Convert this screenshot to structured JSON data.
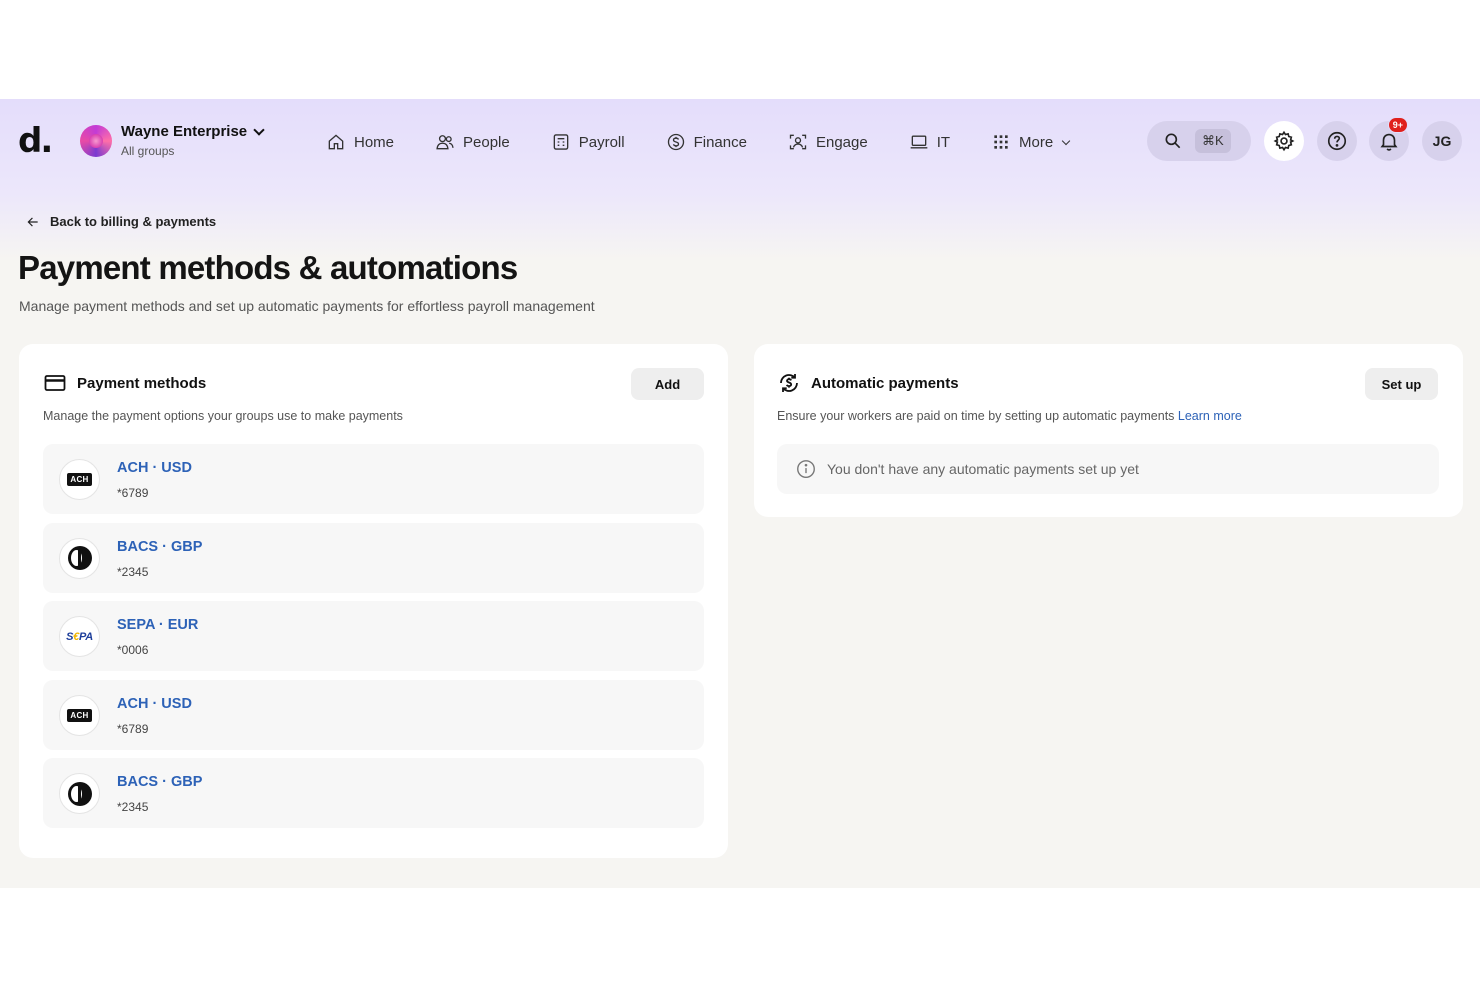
{
  "brand": {
    "logo_text": "d."
  },
  "org": {
    "name": "Wayne Enterprise",
    "subtitle": "All groups"
  },
  "nav": {
    "items": [
      {
        "label": "Home",
        "icon": "home-icon"
      },
      {
        "label": "People",
        "icon": "people-icon"
      },
      {
        "label": "Payroll",
        "icon": "payroll-icon"
      },
      {
        "label": "Finance",
        "icon": "dollar-circle-icon"
      },
      {
        "label": "Engage",
        "icon": "engage-icon"
      },
      {
        "label": "IT",
        "icon": "laptop-icon"
      },
      {
        "label": "More",
        "icon": "grid-icon"
      }
    ]
  },
  "toolbar": {
    "search_shortcut": "⌘K",
    "notification_badge": "9+",
    "user_initials": "JG"
  },
  "page": {
    "back_label": "Back to billing & payments",
    "title": "Payment methods & automations",
    "subtitle": "Manage payment methods and set up automatic payments for effortless payroll management"
  },
  "payment_methods": {
    "title": "Payment methods",
    "description": "Manage the payment options your groups use to make payments",
    "add_label": "Add",
    "items": [
      {
        "title": "ACH · USD",
        "sub": "*6789",
        "logo": "ACH"
      },
      {
        "title": "BACS · GBP",
        "sub": "*2345",
        "logo": "BACS"
      },
      {
        "title": "SEPA · EUR",
        "sub": "*0006",
        "logo": "SEPA"
      },
      {
        "title": "ACH · USD",
        "sub": "*6789",
        "logo": "ACH"
      },
      {
        "title": "BACS · GBP",
        "sub": "*2345",
        "logo": "BACS"
      }
    ]
  },
  "automatic_payments": {
    "title": "Automatic payments",
    "description": "Ensure your workers are paid on time by setting up automatic payments",
    "learn_more": "Learn more",
    "setup_label": "Set up",
    "empty_message": "You don't have any automatic payments set up yet"
  },
  "colors": {
    "accent_link": "#2d62b7",
    "nav_bg": "#e4ddfb",
    "badge": "#e0201c"
  }
}
